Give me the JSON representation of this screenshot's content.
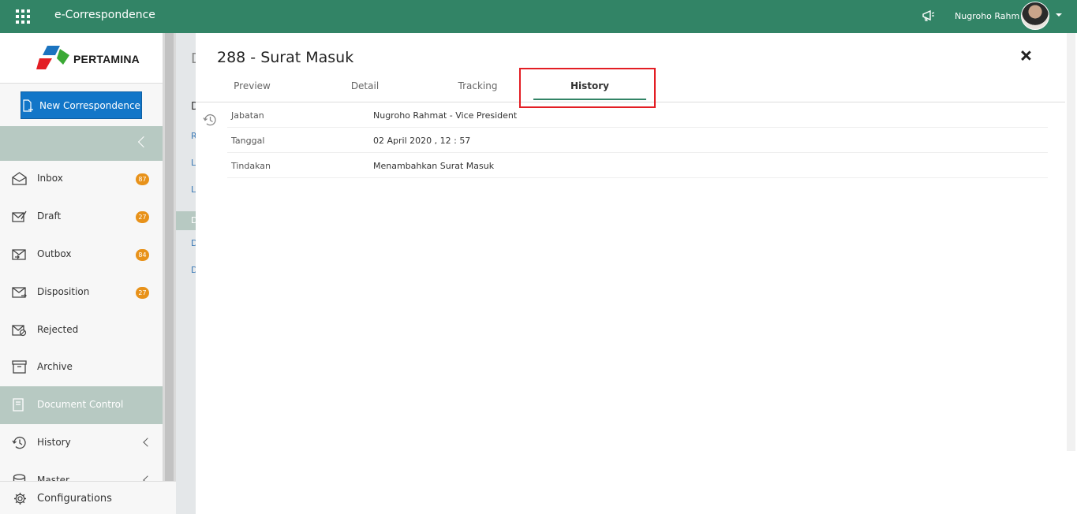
{
  "app": {
    "title": "e-Correspondence"
  },
  "user": {
    "name": "Nugroho Rahm"
  },
  "sidebar": {
    "logo_text": "PERTAMINA",
    "new_button": "New Correspondence",
    "items": [
      {
        "label": "Inbox",
        "badge": "87"
      },
      {
        "label": "Draft",
        "badge": "27"
      },
      {
        "label": "Outbox",
        "badge": "84"
      },
      {
        "label": "Disposition",
        "badge": "27"
      },
      {
        "label": "Rejected"
      },
      {
        "label": "Archive"
      },
      {
        "label": "Document Control"
      },
      {
        "label": "History"
      },
      {
        "label": "Master"
      }
    ],
    "config_label": "Configurations"
  },
  "background_page": {
    "letters": [
      "D",
      "D",
      "R",
      "L",
      "L",
      "D",
      "D",
      "D"
    ]
  },
  "modal": {
    "title": "288 - Surat Masuk",
    "tabs": [
      "Preview",
      "Detail",
      "Tracking",
      "History"
    ],
    "active_tab": "History",
    "history": [
      {
        "key": "Jabatan",
        "value": "Nugroho Rahmat - Vice President"
      },
      {
        "key": "Tanggal",
        "value": "02 April 2020 , 12 : 57"
      },
      {
        "key": "Tindakan",
        "value": "Menambahkan Surat Masuk"
      }
    ]
  },
  "colors": {
    "topbar": "#328466",
    "primary_button": "#1276c8",
    "badge": "#e8921a",
    "highlight": "#e31e24"
  }
}
